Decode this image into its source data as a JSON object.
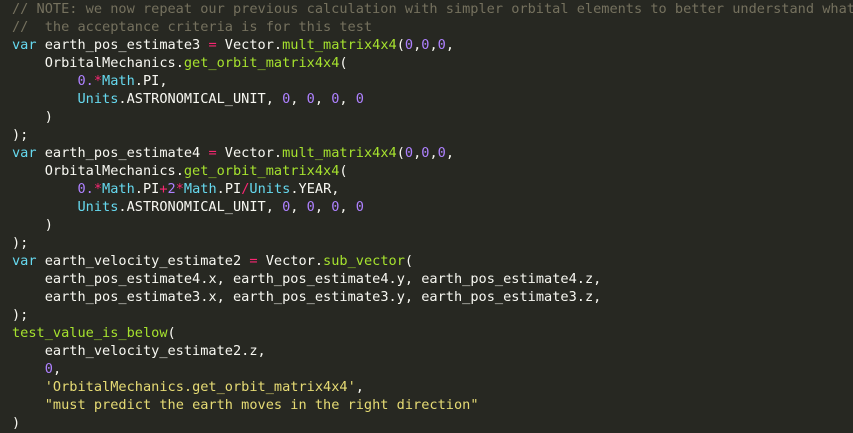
{
  "editor": {
    "colors": {
      "background": "#272822",
      "comment": "#75715e",
      "keyword": "#66d9ef",
      "identifier": "#f8f8f2",
      "operator": "#f92672",
      "function": "#a6e22e",
      "number": "#ae81ff",
      "string": "#e6db74"
    },
    "lines": [
      [
        {
          "t": "comment",
          "v": "// NOTE: we now repeat our previous calculation with simpler orbital elements to better understand what"
        }
      ],
      [
        {
          "t": "comment",
          "v": "//  the acceptance criteria is for this test"
        }
      ],
      [
        {
          "t": "keyword",
          "v": "var"
        },
        {
          "t": "ident",
          "v": " earth_pos_estimate3 "
        },
        {
          "t": "op",
          "v": "="
        },
        {
          "t": "ident",
          "v": " Vector"
        },
        {
          "t": "punc",
          "v": "."
        },
        {
          "t": "func",
          "v": "mult_matrix4x4"
        },
        {
          "t": "punc",
          "v": "("
        },
        {
          "t": "number",
          "v": "0"
        },
        {
          "t": "punc",
          "v": ","
        },
        {
          "t": "number",
          "v": "0"
        },
        {
          "t": "punc",
          "v": ","
        },
        {
          "t": "number",
          "v": "0"
        },
        {
          "t": "punc",
          "v": ","
        }
      ],
      [
        {
          "t": "ident",
          "v": "    OrbitalMechanics"
        },
        {
          "t": "punc",
          "v": "."
        },
        {
          "t": "func",
          "v": "get_orbit_matrix4x4"
        },
        {
          "t": "punc",
          "v": "("
        }
      ],
      [
        {
          "t": "ident",
          "v": "        "
        },
        {
          "t": "number",
          "v": "0."
        },
        {
          "t": "op",
          "v": "*"
        },
        {
          "t": "class",
          "v": "Math"
        },
        {
          "t": "punc",
          "v": "."
        },
        {
          "t": "ident",
          "v": "PI"
        },
        {
          "t": "punc",
          "v": ","
        }
      ],
      [
        {
          "t": "ident",
          "v": "        "
        },
        {
          "t": "class",
          "v": "Units"
        },
        {
          "t": "punc",
          "v": "."
        },
        {
          "t": "ident",
          "v": "ASTRONOMICAL_UNIT"
        },
        {
          "t": "punc",
          "v": ", "
        },
        {
          "t": "number",
          "v": "0"
        },
        {
          "t": "punc",
          "v": ", "
        },
        {
          "t": "number",
          "v": "0"
        },
        {
          "t": "punc",
          "v": ", "
        },
        {
          "t": "number",
          "v": "0"
        },
        {
          "t": "punc",
          "v": ", "
        },
        {
          "t": "number",
          "v": "0"
        }
      ],
      [
        {
          "t": "punc",
          "v": "    )"
        }
      ],
      [
        {
          "t": "punc",
          "v": ");"
        }
      ],
      [
        {
          "t": "keyword",
          "v": "var"
        },
        {
          "t": "ident",
          "v": " earth_pos_estimate4 "
        },
        {
          "t": "op",
          "v": "="
        },
        {
          "t": "ident",
          "v": " Vector"
        },
        {
          "t": "punc",
          "v": "."
        },
        {
          "t": "func",
          "v": "mult_matrix4x4"
        },
        {
          "t": "punc",
          "v": "("
        },
        {
          "t": "number",
          "v": "0"
        },
        {
          "t": "punc",
          "v": ","
        },
        {
          "t": "number",
          "v": "0"
        },
        {
          "t": "punc",
          "v": ","
        },
        {
          "t": "number",
          "v": "0"
        },
        {
          "t": "punc",
          "v": ","
        }
      ],
      [
        {
          "t": "ident",
          "v": "    OrbitalMechanics"
        },
        {
          "t": "punc",
          "v": "."
        },
        {
          "t": "func",
          "v": "get_orbit_matrix4x4"
        },
        {
          "t": "punc",
          "v": "("
        }
      ],
      [
        {
          "t": "ident",
          "v": "        "
        },
        {
          "t": "number",
          "v": "0."
        },
        {
          "t": "op",
          "v": "*"
        },
        {
          "t": "class",
          "v": "Math"
        },
        {
          "t": "punc",
          "v": "."
        },
        {
          "t": "ident",
          "v": "PI"
        },
        {
          "t": "op",
          "v": "+"
        },
        {
          "t": "number",
          "v": "2"
        },
        {
          "t": "op",
          "v": "*"
        },
        {
          "t": "class",
          "v": "Math"
        },
        {
          "t": "punc",
          "v": "."
        },
        {
          "t": "ident",
          "v": "PI"
        },
        {
          "t": "op",
          "v": "/"
        },
        {
          "t": "class",
          "v": "Units"
        },
        {
          "t": "punc",
          "v": "."
        },
        {
          "t": "ident",
          "v": "YEAR"
        },
        {
          "t": "punc",
          "v": ","
        }
      ],
      [
        {
          "t": "ident",
          "v": "        "
        },
        {
          "t": "class",
          "v": "Units"
        },
        {
          "t": "punc",
          "v": "."
        },
        {
          "t": "ident",
          "v": "ASTRONOMICAL_UNIT"
        },
        {
          "t": "punc",
          "v": ", "
        },
        {
          "t": "number",
          "v": "0"
        },
        {
          "t": "punc",
          "v": ", "
        },
        {
          "t": "number",
          "v": "0"
        },
        {
          "t": "punc",
          "v": ", "
        },
        {
          "t": "number",
          "v": "0"
        },
        {
          "t": "punc",
          "v": ", "
        },
        {
          "t": "number",
          "v": "0"
        }
      ],
      [
        {
          "t": "punc",
          "v": "    )"
        }
      ],
      [
        {
          "t": "punc",
          "v": ");"
        }
      ],
      [
        {
          "t": "keyword",
          "v": "var"
        },
        {
          "t": "ident",
          "v": " earth_velocity_estimate2 "
        },
        {
          "t": "op",
          "v": "="
        },
        {
          "t": "ident",
          "v": " Vector"
        },
        {
          "t": "punc",
          "v": "."
        },
        {
          "t": "func",
          "v": "sub_vector"
        },
        {
          "t": "punc",
          "v": "("
        }
      ],
      [
        {
          "t": "ident",
          "v": "    earth_pos_estimate4"
        },
        {
          "t": "punc",
          "v": "."
        },
        {
          "t": "ident",
          "v": "x"
        },
        {
          "t": "punc",
          "v": ", "
        },
        {
          "t": "ident",
          "v": "earth_pos_estimate4"
        },
        {
          "t": "punc",
          "v": "."
        },
        {
          "t": "ident",
          "v": "y"
        },
        {
          "t": "punc",
          "v": ", "
        },
        {
          "t": "ident",
          "v": "earth_pos_estimate4"
        },
        {
          "t": "punc",
          "v": "."
        },
        {
          "t": "ident",
          "v": "z"
        },
        {
          "t": "punc",
          "v": ","
        }
      ],
      [
        {
          "t": "ident",
          "v": "    earth_pos_estimate3"
        },
        {
          "t": "punc",
          "v": "."
        },
        {
          "t": "ident",
          "v": "x"
        },
        {
          "t": "punc",
          "v": ", "
        },
        {
          "t": "ident",
          "v": "earth_pos_estimate3"
        },
        {
          "t": "punc",
          "v": "."
        },
        {
          "t": "ident",
          "v": "y"
        },
        {
          "t": "punc",
          "v": ", "
        },
        {
          "t": "ident",
          "v": "earth_pos_estimate3"
        },
        {
          "t": "punc",
          "v": "."
        },
        {
          "t": "ident",
          "v": "z"
        },
        {
          "t": "punc",
          "v": ","
        }
      ],
      [
        {
          "t": "punc",
          "v": ");"
        }
      ],
      [
        {
          "t": "func",
          "v": "test_value_is_below"
        },
        {
          "t": "punc",
          "v": "("
        }
      ],
      [
        {
          "t": "ident",
          "v": "    earth_velocity_estimate2"
        },
        {
          "t": "punc",
          "v": "."
        },
        {
          "t": "ident",
          "v": "z"
        },
        {
          "t": "punc",
          "v": ","
        }
      ],
      [
        {
          "t": "ident",
          "v": "    "
        },
        {
          "t": "number",
          "v": "0"
        },
        {
          "t": "punc",
          "v": ","
        }
      ],
      [
        {
          "t": "ident",
          "v": "    "
        },
        {
          "t": "string",
          "v": "'OrbitalMechanics.get_orbit_matrix4x4'"
        },
        {
          "t": "punc",
          "v": ","
        }
      ],
      [
        {
          "t": "ident",
          "v": "    "
        },
        {
          "t": "string",
          "v": "\"must predict the earth moves in the right direction\""
        }
      ],
      [
        {
          "t": "punc",
          "v": ")"
        }
      ]
    ]
  }
}
